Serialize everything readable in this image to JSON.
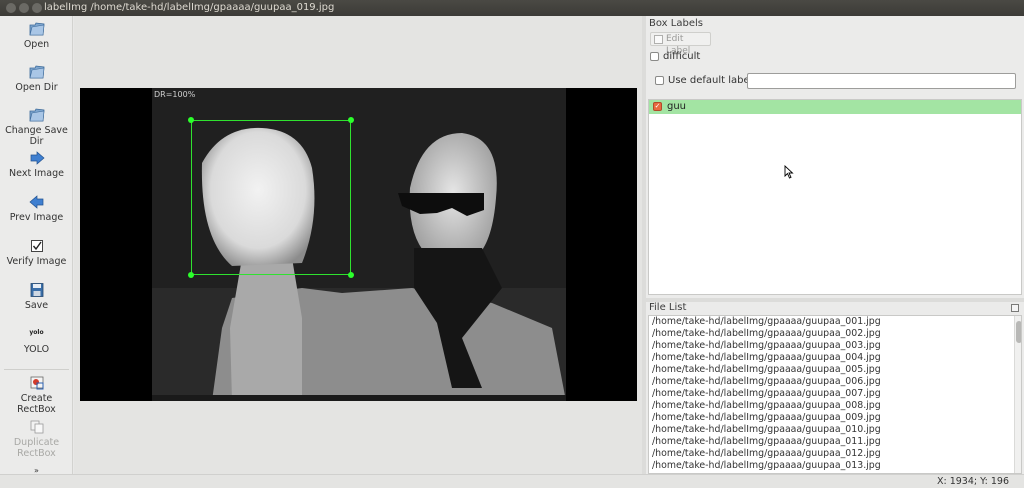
{
  "window": {
    "title": "labelImg /home/take-hd/labelImg/gpaaaa/guupaa_019.jpg"
  },
  "toolbar": {
    "items": [
      {
        "label": "Open",
        "icon": "folder-icon"
      },
      {
        "label": "Open Dir",
        "icon": "folder-icon"
      },
      {
        "label": "Change Save Dir",
        "icon": "folder-icon"
      },
      {
        "label": "Next Image",
        "icon": "arrow-right-icon"
      },
      {
        "label": "Prev Image",
        "icon": "arrow-left-icon"
      },
      {
        "label": "Verify Image",
        "icon": "checkbox-icon"
      },
      {
        "label": "Save",
        "icon": "floppy-disk-icon"
      },
      {
        "label": "YOLO",
        "icon": "yolo-icon",
        "icon_text": "yolo"
      },
      {
        "label": "Create\nRectBox",
        "icon": "rectbox-icon"
      },
      {
        "label": "Duplicate\nRectBox",
        "icon": "duplicate-icon"
      }
    ],
    "more_icon": "chevron-down-icon"
  },
  "canvas": {
    "overlay_text": "DR=100%",
    "box_color": "#2fe22f"
  },
  "box_labels": {
    "title": "Box Labels",
    "edit_label_button": "Edit Label",
    "difficult_label": "difficult",
    "use_default_label": "Use default label",
    "default_label_value": "",
    "labels": [
      {
        "text": "guu",
        "checked": true,
        "color": "#a3e4a3"
      }
    ]
  },
  "file_list": {
    "title": "File List",
    "files": [
      "/home/take-hd/labelImg/gpaaaa/guupaa_001.jpg",
      "/home/take-hd/labelImg/gpaaaa/guupaa_002.jpg",
      "/home/take-hd/labelImg/gpaaaa/guupaa_003.jpg",
      "/home/take-hd/labelImg/gpaaaa/guupaa_004.jpg",
      "/home/take-hd/labelImg/gpaaaa/guupaa_005.jpg",
      "/home/take-hd/labelImg/gpaaaa/guupaa_006.jpg",
      "/home/take-hd/labelImg/gpaaaa/guupaa_007.jpg",
      "/home/take-hd/labelImg/gpaaaa/guupaa_008.jpg",
      "/home/take-hd/labelImg/gpaaaa/guupaa_009.jpg",
      "/home/take-hd/labelImg/gpaaaa/guupaa_010.jpg",
      "/home/take-hd/labelImg/gpaaaa/guupaa_011.jpg",
      "/home/take-hd/labelImg/gpaaaa/guupaa_012.jpg",
      "/home/take-hd/labelImg/gpaaaa/guupaa_013.jpg"
    ]
  },
  "status": {
    "text": "X: 1934; Y: 196"
  }
}
